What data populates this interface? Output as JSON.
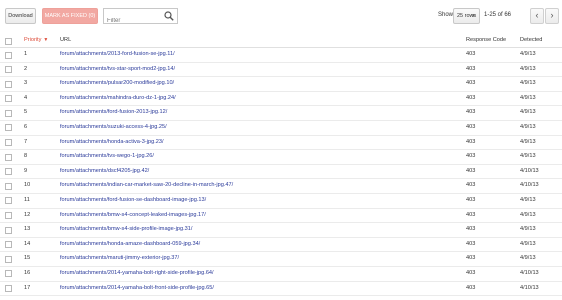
{
  "toolbar": {
    "download_label": "Download",
    "mark_fixed_label": "MARK AS FIXED (0)",
    "filter_placeholder": "Filter",
    "show_label": "Show",
    "rows_value": "25 rows",
    "range_text": "1-25 of 66"
  },
  "columns": {
    "priority": "Priority",
    "url": "URL",
    "response_code": "Response Code",
    "detected": "Detected"
  },
  "rows": [
    {
      "priority": "1",
      "url": "forum/attachments/2013-ford-fusion-se-jpg.11/",
      "code": "403",
      "detected": "4/9/13"
    },
    {
      "priority": "2",
      "url": "forum/attachments/tvs-star-sport-mod2-jpg.14/",
      "code": "403",
      "detected": "4/9/13"
    },
    {
      "priority": "3",
      "url": "forum/attachments/pulsar200-modified-jpg.10/",
      "code": "403",
      "detected": "4/9/13"
    },
    {
      "priority": "4",
      "url": "forum/attachments/mahindra-duro-dz-1-jpg.24/",
      "code": "403",
      "detected": "4/9/13"
    },
    {
      "priority": "5",
      "url": "forum/attachments/ford-fusion-2013-jpg.12/",
      "code": "403",
      "detected": "4/9/13"
    },
    {
      "priority": "6",
      "url": "forum/attachments/suzuki-access-4-jpg.25/",
      "code": "403",
      "detected": "4/9/13"
    },
    {
      "priority": "7",
      "url": "forum/attachments/honda-activa-3-jpg.23/",
      "code": "403",
      "detected": "4/9/13"
    },
    {
      "priority": "8",
      "url": "forum/attachments/tvs-wego-1-jpg.26/",
      "code": "403",
      "detected": "4/9/13"
    },
    {
      "priority": "9",
      "url": "forum/attachments/dscf4205-jpg.42/",
      "code": "403",
      "detected": "4/10/13"
    },
    {
      "priority": "10",
      "url": "forum/attachments/indian-car-market-saw-20-decline-in-march-jpg.47/",
      "code": "403",
      "detected": "4/10/13"
    },
    {
      "priority": "11",
      "url": "forum/attachments/ford-fusion-se-dashboard-image-jpg.13/",
      "code": "403",
      "detected": "4/9/13"
    },
    {
      "priority": "12",
      "url": "forum/attachments/bmw-s4-concept-leaked-images-jpg.17/",
      "code": "403",
      "detected": "4/9/13"
    },
    {
      "priority": "13",
      "url": "forum/attachments/bmw-s4-side-profile-image-jpg.31/",
      "code": "403",
      "detected": "4/9/13"
    },
    {
      "priority": "14",
      "url": "forum/attachments/honda-amaze-dashboard-059-jpg.34/",
      "code": "403",
      "detected": "4/9/13"
    },
    {
      "priority": "15",
      "url": "forum/attachments/maruti-jimmy-exterior-jpg.37/",
      "code": "403",
      "detected": "4/9/13"
    },
    {
      "priority": "16",
      "url": "forum/attachments/2014-yamaha-bolt-right-side-profile-jpg.64/",
      "code": "403",
      "detected": "4/10/13"
    },
    {
      "priority": "17",
      "url": "forum/attachments/2014-yamaha-bolt-front-side-profile-jpg.65/",
      "code": "403",
      "detected": "4/10/13"
    }
  ]
}
